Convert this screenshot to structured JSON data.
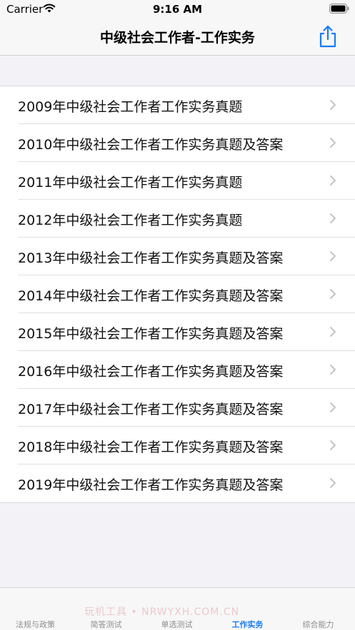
{
  "status_bar": {
    "carrier": "Carrier",
    "time": "9:16 AM"
  },
  "nav": {
    "title": "中级社会工作者-工作实务",
    "share_icon": "share-icon"
  },
  "list": {
    "items": [
      {
        "label": "2009年中级社会工作者工作实务真题"
      },
      {
        "label": "2010年中级社会工作者工作实务真题及答案"
      },
      {
        "label": "2011年中级社会工作者工作实务真题"
      },
      {
        "label": "2012年中级社会工作者工作实务真题"
      },
      {
        "label": "2013年中级社会工作者工作实务真题及答案"
      },
      {
        "label": "2014年中级社会工作者工作实务真题及答案"
      },
      {
        "label": "2015年中级社会工作者工作实务真题及答案"
      },
      {
        "label": "2016年中级社会工作者工作实务真题及答案"
      },
      {
        "label": "2017年中级社会工作者工作实务真题及答案"
      },
      {
        "label": "2018年中级社会工作者工作实务真题及答案"
      },
      {
        "label": "2019年中级社会工作者工作实务真题及答案"
      }
    ]
  },
  "tab_bar": {
    "tabs": [
      {
        "label": "法规与政策",
        "active": false
      },
      {
        "label": "简答测试",
        "active": false
      },
      {
        "label": "单选测试",
        "active": false
      },
      {
        "label": "工作实务",
        "active": true
      },
      {
        "label": "综合能力",
        "active": false
      }
    ],
    "watermark": "玩机工具 • NRWYXH.COM.CN"
  },
  "colors": {
    "accent": "#1a7cf5",
    "background": "#f2f2f7",
    "inactive_tab": "#8e8e93"
  }
}
